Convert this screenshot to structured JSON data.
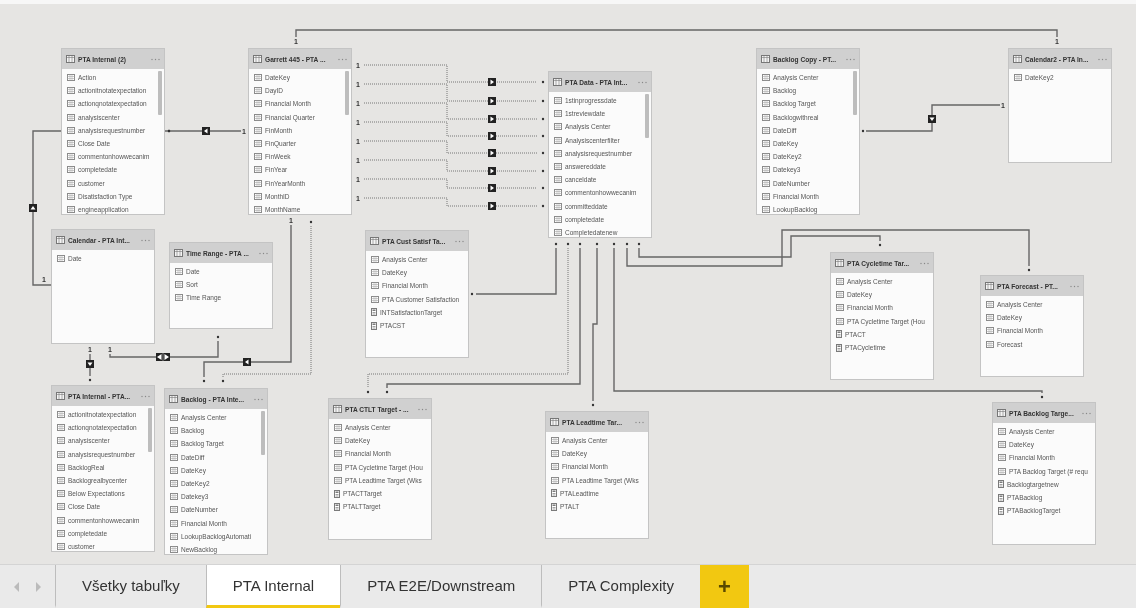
{
  "tables": [
    {
      "title": "PTA Internal (2)",
      "columns": [
        "Action",
        "actionitnotatexpectation",
        "actionqnotatexpectation",
        "analysiscenter",
        "analysisrequestnumber",
        "Close Date",
        "commentonhowwecanim",
        "completedate",
        "customer",
        "Disatisfaction Type",
        "engineapplication"
      ],
      "scrollable": true
    },
    {
      "title": "Garrett 445 - PTA ...",
      "columns": [
        "DateKey",
        "DayID",
        "Financial Month",
        "Financial Quarter",
        "FinMonth",
        "FinQuarter",
        "FinWeek",
        "FinYear",
        "FinYearMonth",
        "MonthID",
        "MonthName"
      ],
      "scrollable": true
    },
    {
      "title": "PTA Data - PTA Int...",
      "columns": [
        "1stinprogressdate",
        "1streviewdate",
        "Analysis Center",
        "Analysiscenterfilter",
        "analysisrequestnumber",
        "answereddate",
        "canceldate",
        "commentonhowwecanim",
        "committeddate",
        "completedate",
        "Completedatenew"
      ],
      "scrollable": true
    },
    {
      "title": "Backlog Copy - PT...",
      "columns": [
        "Analysis Center",
        "Backlog",
        "Backlog Target",
        "Backlogwithreal",
        "DateDiff",
        "DateKey",
        "DateKey2",
        "Datekey3",
        "DateNumber",
        "Financial Month",
        "LookupBacklog"
      ],
      "scrollable": true
    },
    {
      "title": "Calendar2 - PTA In...",
      "columns": [
        "DateKey2"
      ],
      "scrollable": false
    },
    {
      "title": "Calendar - PTA Int...",
      "columns": [
        "Date"
      ],
      "scrollable": false
    },
    {
      "title": "Time Range - PTA ...",
      "columns": [
        "Date",
        "Sort",
        "Time Range"
      ],
      "scrollable": false
    },
    {
      "title": "PTA Cust Satisf Ta...",
      "columns": [
        "Analysis Center",
        "DateKey",
        "Financial Month",
        "PTA Customer Satisfaction"
      ],
      "measures": [
        "INTSatisfactionTarget",
        "PTACST"
      ],
      "scrollable": false
    },
    {
      "title": "PTA Cycletime Tar...",
      "columns": [
        "Analysis Center",
        "DateKey",
        "Financial Month",
        "PTA Cycletime Target (Hou"
      ],
      "measures": [
        "PTACT",
        "PTACycletime"
      ],
      "scrollable": false
    },
    {
      "title": "PTA Forecast - PT...",
      "columns": [
        "Analysis Center",
        "DateKey",
        "Financial Month",
        "Forecast"
      ],
      "scrollable": false
    },
    {
      "title": "PTA Internal - PTA...",
      "columns": [
        "actionitnotatexpectation",
        "actionqnotatexpectation",
        "analysiscenter",
        "analysisrequestnumber",
        "BacklogReal",
        "Backlogrealbycenter",
        "Below Expectations",
        "Close Date",
        "commentonhowwecanim",
        "completedate",
        "customer"
      ],
      "scrollable": true
    },
    {
      "title": "Backlog - PTA Inte...",
      "columns": [
        "Analysis Center",
        "Backlog",
        "Backlog Target",
        "DateDiff",
        "DateKey",
        "DateKey2",
        "Datekey3",
        "DateNumber",
        "Financial Month",
        "LookupBacklogAutomati",
        "NewBacklog"
      ],
      "scrollable": true
    },
    {
      "title": "PTA CTLT Target - ...",
      "columns": [
        "Analysis Center",
        "DateKey",
        "Financial Month",
        "PTA Cycletime Target (Hou",
        "PTA Leadtime Target (Wks"
      ],
      "measures": [
        "PTACTTarget",
        "PTALTTarget"
      ],
      "scrollable": false
    },
    {
      "title": "PTA Leadtime Tar...",
      "columns": [
        "Analysis Center",
        "DateKey",
        "Financial Month",
        "PTA Leadtime Target (Wks"
      ],
      "measures": [
        "PTALeadtime",
        "PTALT"
      ],
      "scrollable": false
    },
    {
      "title": "PTA Backlog Targe...",
      "columns": [
        "Analysis Center",
        "DateKey",
        "Financial Month",
        "PTA Backlog Target (# requ"
      ],
      "measures": [
        "Backlogtargetnew",
        "PTABacklog",
        "PTABacklogTarget"
      ],
      "scrollable": false
    }
  ],
  "relationships": [
    {
      "kind": "solid",
      "labels": [
        "1",
        "1"
      ]
    },
    {
      "kind": "solid",
      "bidirectional": false,
      "labels": [
        "1"
      ]
    },
    {
      "kind": "solid",
      "bidirectional": false,
      "labels": [
        "1"
      ]
    },
    {
      "kind": "dotted",
      "bidirectional": false,
      "labels": [
        "1"
      ]
    },
    {
      "kind": "dotted",
      "bidirectional": false,
      "labels": [
        "1"
      ]
    },
    {
      "kind": "dotted",
      "bidirectional": false,
      "labels": [
        "1"
      ]
    },
    {
      "kind": "dotted",
      "bidirectional": false,
      "labels": [
        "1"
      ]
    },
    {
      "kind": "dotted",
      "bidirectional": false,
      "labels": [
        "1"
      ]
    },
    {
      "kind": "dotted",
      "bidirectional": false,
      "labels": [
        "1"
      ]
    },
    {
      "kind": "dotted",
      "bidirectional": false,
      "labels": [
        "1"
      ]
    },
    {
      "kind": "dotted",
      "bidirectional": false,
      "labels": [
        "1"
      ]
    },
    {
      "kind": "solid",
      "bidirectional": false,
      "labels": [
        "1"
      ]
    },
    {
      "kind": "solid",
      "bidirectional": false,
      "labels": [
        "1"
      ]
    },
    {
      "kind": "solid",
      "bidirectional": true,
      "labels": [
        "1"
      ]
    },
    {
      "kind": "solid",
      "bidirectional": false,
      "labels": [
        "1"
      ]
    },
    {
      "kind": "dotted"
    },
    {
      "kind": "dotted"
    },
    {
      "kind": "solid"
    },
    {
      "kind": "solid"
    },
    {
      "kind": "solid"
    },
    {
      "kind": "solid"
    },
    {
      "kind": "solid"
    },
    {
      "kind": "solid"
    }
  ],
  "tabs": [
    {
      "label": "Všetky tabuľky",
      "selected": false
    },
    {
      "label": "PTA Internal",
      "selected": true
    },
    {
      "label": "PTA E2E/Downstream",
      "selected": false
    },
    {
      "label": "PTA Complexity",
      "selected": false
    }
  ],
  "add_tab": {
    "label": "+"
  }
}
